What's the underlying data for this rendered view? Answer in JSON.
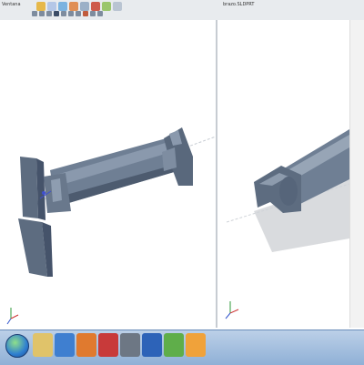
{
  "toolbar": {
    "left_view_label": "Ventana",
    "right_view_label": "brazo.SLDPRT"
  },
  "icons": {
    "left_viewport_triad": "coordinate-triad-icon",
    "right_viewport_triad": "coordinate-triad-icon",
    "start": "windows-start-icon",
    "taskbar_apps": [
      "windows-explorer-icon",
      "media-player-icon",
      "firefox-icon",
      "solidworks-icon",
      "camera-icon",
      "word-icon",
      "chrome-icon",
      "blender-icon"
    ]
  },
  "colors": {
    "model_body": "#6f7f94",
    "model_dark": "#4d5b6f",
    "taskbar": "#a9c4e3"
  }
}
